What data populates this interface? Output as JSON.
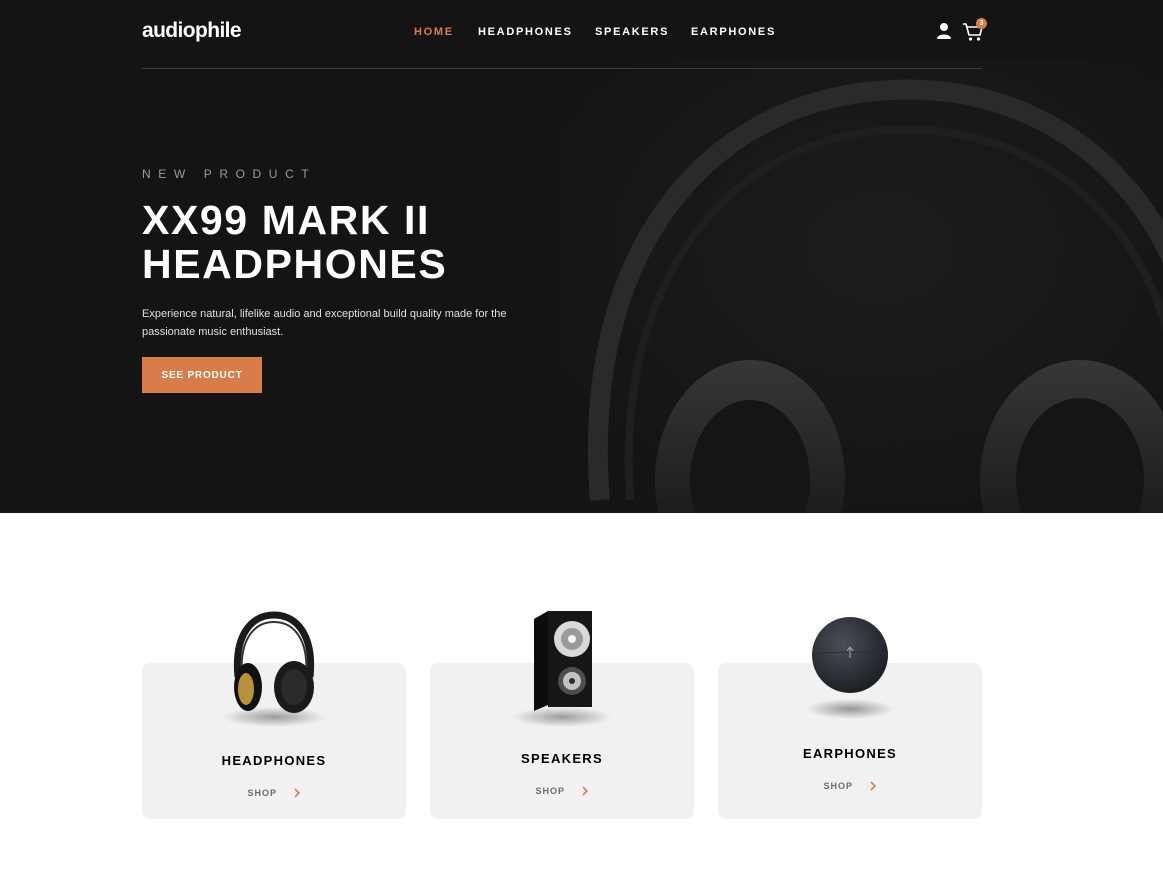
{
  "brand": {
    "name": "audiophile",
    "accent": "#d87d4a",
    "dark": "#141414",
    "card_bg": "#f1f1f1"
  },
  "nav": {
    "items": [
      {
        "label": "HOME",
        "active": true
      },
      {
        "label": "HEADPHONES",
        "active": false
      },
      {
        "label": "SPEAKERS",
        "active": false
      },
      {
        "label": "EARPHONES",
        "active": false
      }
    ],
    "user_icon": "user-icon",
    "cart_icon": "cart-icon",
    "cart_count": "3"
  },
  "hero": {
    "overline": "NEW PRODUCT",
    "title": "XX99 MARK II HEADPHONES",
    "description": "Experience natural, lifelike audio and exceptional build quality made for the passionate music enthusiast.",
    "cta": "SEE PRODUCT"
  },
  "categories": [
    {
      "title": "HEADPHONES",
      "link": "SHOP",
      "icon": "headphones-image"
    },
    {
      "title": "SPEAKERS",
      "link": "SHOP",
      "icon": "speaker-image"
    },
    {
      "title": "EARPHONES",
      "link": "SHOP",
      "icon": "earphones-case-image"
    }
  ]
}
